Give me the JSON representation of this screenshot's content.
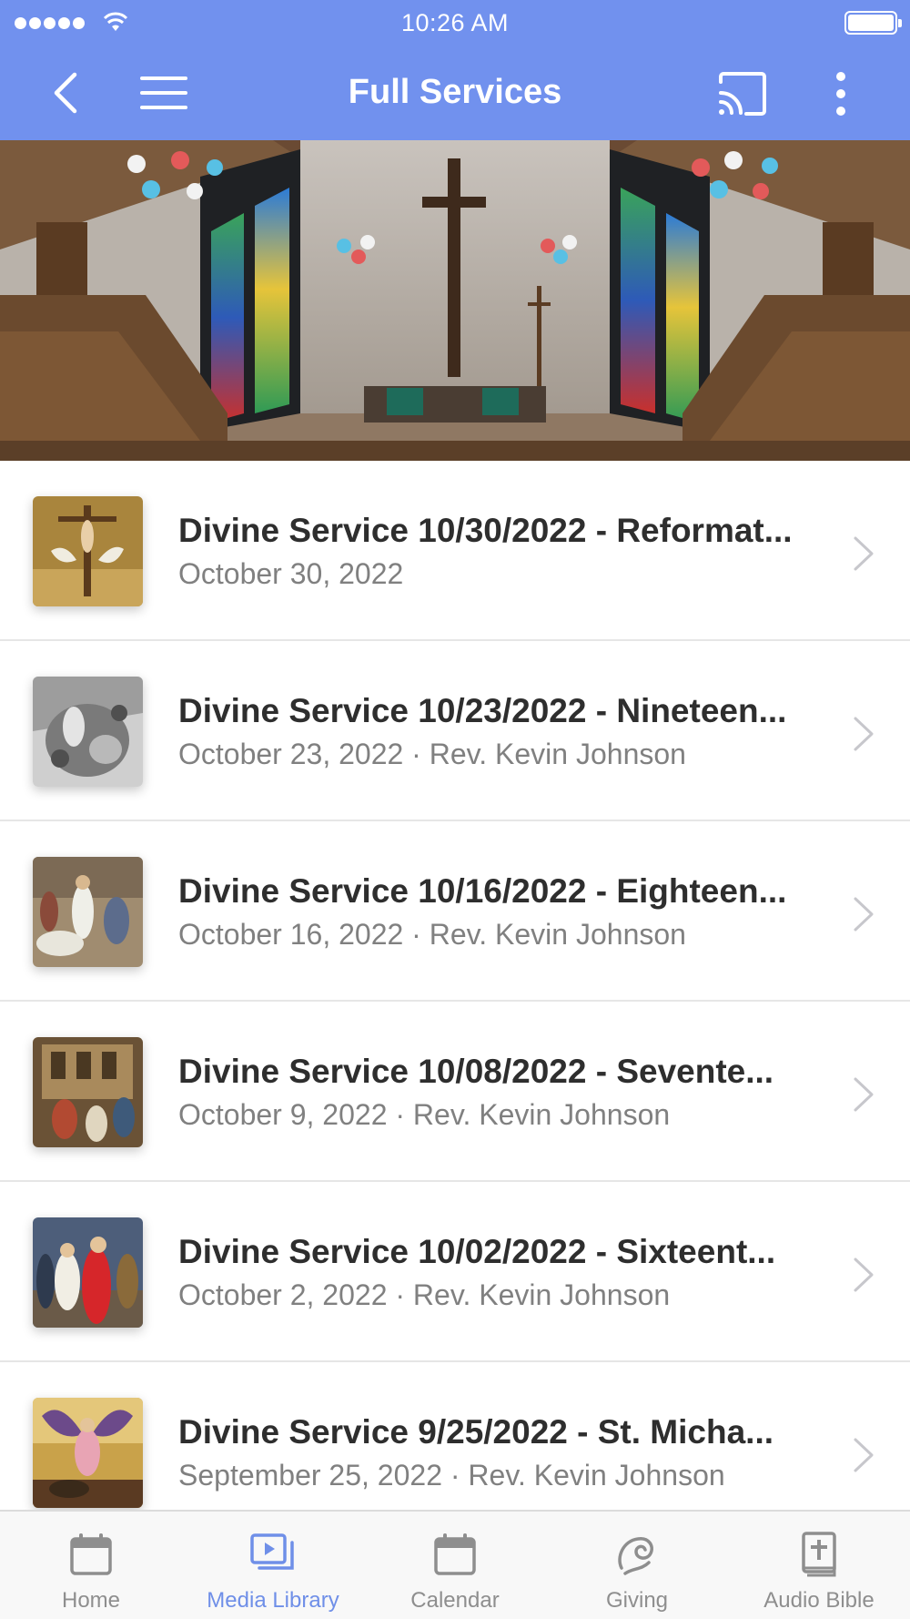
{
  "status_bar": {
    "time": "10:26 AM"
  },
  "header": {
    "title": "Full Services"
  },
  "colors": {
    "header_bg": "#7191ee",
    "tab_active": "#6f8fe8",
    "tab_inactive": "#8e8e8e"
  },
  "services": [
    {
      "title": "Divine Service 10/30/2022 - Reformat...",
      "subtitle": "October 30, 2022",
      "thumb_icon": "crucifixion-painting"
    },
    {
      "title": "Divine Service 10/23/2022 - Nineteen...",
      "subtitle": "October 23, 2022 · Rev. Kevin Johnson",
      "thumb_icon": "engraving-crowd"
    },
    {
      "title": "Divine Service 10/16/2022 - Eighteen...",
      "subtitle": "October 16, 2022 · Rev. Kevin Johnson",
      "thumb_icon": "healing-painting"
    },
    {
      "title": "Divine Service 10/08/2022 - Sevente...",
      "subtitle": "October 9, 2022 · Rev. Kevin Johnson",
      "thumb_icon": "market-painting"
    },
    {
      "title": "Divine Service 10/02/2022 - Sixteent...",
      "subtitle": "October 2, 2022 · Rev. Kevin Johnson",
      "thumb_icon": "christ-red-robe-painting"
    },
    {
      "title": "Divine Service 9/25/2022 - St. Micha...",
      "subtitle": "September 25, 2022 · Rev. Kevin Johnson",
      "thumb_icon": "archangel-michael-painting"
    }
  ],
  "tabs": [
    {
      "label": "Home",
      "icon": "calendar-icon",
      "active": false
    },
    {
      "label": "Media Library",
      "icon": "media-library-icon",
      "active": true
    },
    {
      "label": "Calendar",
      "icon": "calendar-icon",
      "active": false
    },
    {
      "label": "Giving",
      "icon": "giving-icon",
      "active": false
    },
    {
      "label": "Audio Bible",
      "icon": "bible-icon",
      "active": false
    }
  ]
}
